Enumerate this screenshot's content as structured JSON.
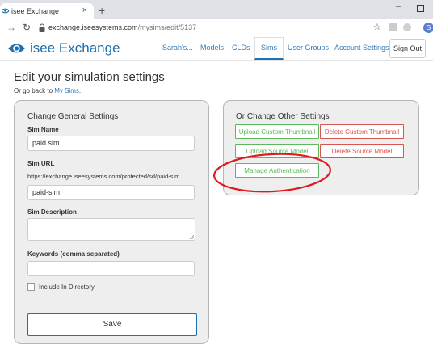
{
  "browser": {
    "tab_title": "isee Exchange",
    "new_tab": "+",
    "tab_close": "×",
    "url_host": "exchange.iseesystems.com",
    "url_path": "/mysims/edit/5137",
    "profile_initial": "S",
    "minimize": "–"
  },
  "header": {
    "logo_text": "isee Exchange",
    "nav": [
      "Sarah's...",
      "Models",
      "CLDs",
      "Sims",
      "User Groups",
      "Account Settings"
    ],
    "active_nav": "Sims",
    "signout": "Sign Out",
    "brand_color": "#1d6fae"
  },
  "page": {
    "title": "Edit your simulation settings",
    "goback_prefix": "Or go back to ",
    "goback_link": "My Sims",
    "goback_suffix": "."
  },
  "general": {
    "title": "Change General Settings",
    "sim_name_label": "Sim Name",
    "sim_name_value": "paid sim",
    "sim_url_label": "Sim URL",
    "sim_url_prefix": "https://exchange.iseesystems.com/protected/sd/paid-sim",
    "sim_url_value": "paid-sim",
    "description_label": "Sim Description",
    "description_value": "",
    "keywords_label": "Keywords (comma separated)",
    "keywords_value": "",
    "include_label": "Include In Directory",
    "include_checked": false,
    "save": "Save"
  },
  "other": {
    "title": "Or Change Other Settings",
    "upload_thumbnail": "Upload Custom Thumbnail",
    "delete_thumbnail": "Delete Custom Thumbnail",
    "upload_source": "Upload Source Model",
    "delete_source": "Delete Source Model",
    "manage_auth": "Manage Authentication"
  },
  "colors": {
    "green": "#5cb85c",
    "red": "#d9534f",
    "annotation": "#e0191f"
  }
}
